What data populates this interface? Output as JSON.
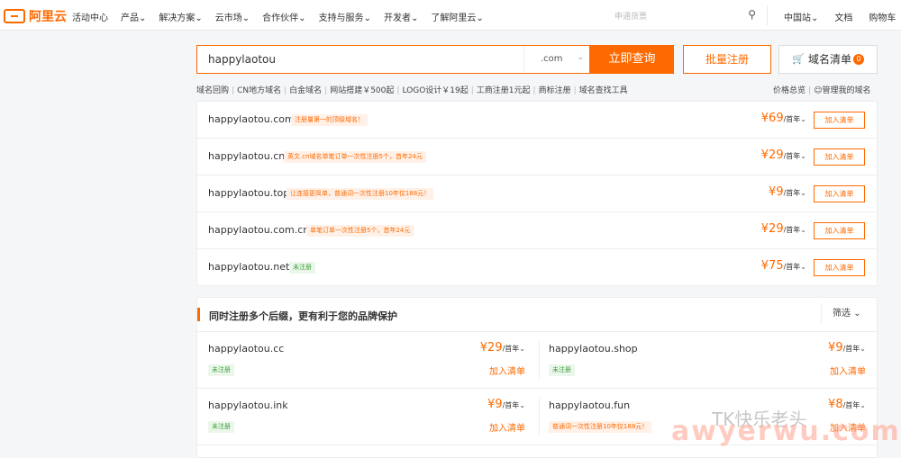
{
  "header": {
    "logo_text": "阿里云",
    "nav": [
      "活动中心",
      "产品",
      "解决方案",
      "云市场",
      "合作伙伴",
      "支持与服务",
      "开发者",
      "了解阿里云"
    ],
    "nav_has_chevron": [
      false,
      true,
      true,
      true,
      true,
      true,
      true,
      true
    ],
    "search_placeholder": "申通货票",
    "right": [
      "中国站",
      "文档",
      "购物车"
    ]
  },
  "search": {
    "value": "happylaotou",
    "suffix": ".com",
    "query_label": "立即查询",
    "batch_label": "批量注册",
    "list_label": "域名清单",
    "list_count": "0"
  },
  "quick_links": [
    "域名回购",
    "CN地方域名",
    "白金域名",
    "网站搭建￥500起",
    "LOGO设计￥19起",
    "工商注册1元起",
    "商标注册",
    "域名查找工具"
  ],
  "right_links": [
    "价格总览",
    "管理我的域名"
  ],
  "results": [
    {
      "domain": "happylaotou.com",
      "tag": "注册量第一的顶级域名！",
      "tag_type": "promo",
      "price": "69",
      "unit": "/首年",
      "add": "加入清单"
    },
    {
      "domain": "happylaotou.cn",
      "tag": "英文.cn域名单笔订单一次性注册5个，首年24元",
      "tag_type": "promo",
      "price": "29",
      "unit": "/首年",
      "add": "加入清单"
    },
    {
      "domain": "happylaotou.top",
      "tag": "让连接更简单，普通词一次性注册10年仅188元！",
      "tag_type": "promo",
      "price": "9",
      "unit": "/首年",
      "add": "加入清单"
    },
    {
      "domain": "happylaotou.com.cn",
      "tag": "单笔订单一次性注册5个，首年24元",
      "tag_type": "promo",
      "price": "29",
      "unit": "/首年",
      "add": "加入清单"
    },
    {
      "domain": "happylaotou.net",
      "tag": "未注册",
      "tag_type": "free",
      "price": "75",
      "unit": "/首年",
      "add": "加入清单"
    }
  ],
  "section": {
    "title": "同时注册多个后缀，更有利于您的品牌保护",
    "filter_label": "筛选",
    "items": [
      {
        "domain": "happylaotou.cc",
        "tag": "未注册",
        "tag_type": "free",
        "price": "29",
        "unit": "/首年",
        "add": "加入清单"
      },
      {
        "domain": "happylaotou.shop",
        "tag": "未注册",
        "tag_type": "free",
        "price": "9",
        "unit": "/首年",
        "add": "加入清单"
      },
      {
        "domain": "happylaotou.ink",
        "tag": "未注册",
        "tag_type": "free",
        "price": "9",
        "unit": "/首年",
        "add": "加入清单"
      },
      {
        "domain": "happylaotou.fun",
        "tag": "普通词一次性注册10年仅188元！",
        "tag_type": "promo",
        "price": "8",
        "unit": "/首年",
        "add": "加入清单"
      }
    ]
  },
  "currency": "¥",
  "watermark": {
    "brand": "TK快乐老头",
    "url": "awyerwu.com"
  },
  "colors": {
    "accent": "#ff6a00",
    "free": "#3fa03f"
  }
}
